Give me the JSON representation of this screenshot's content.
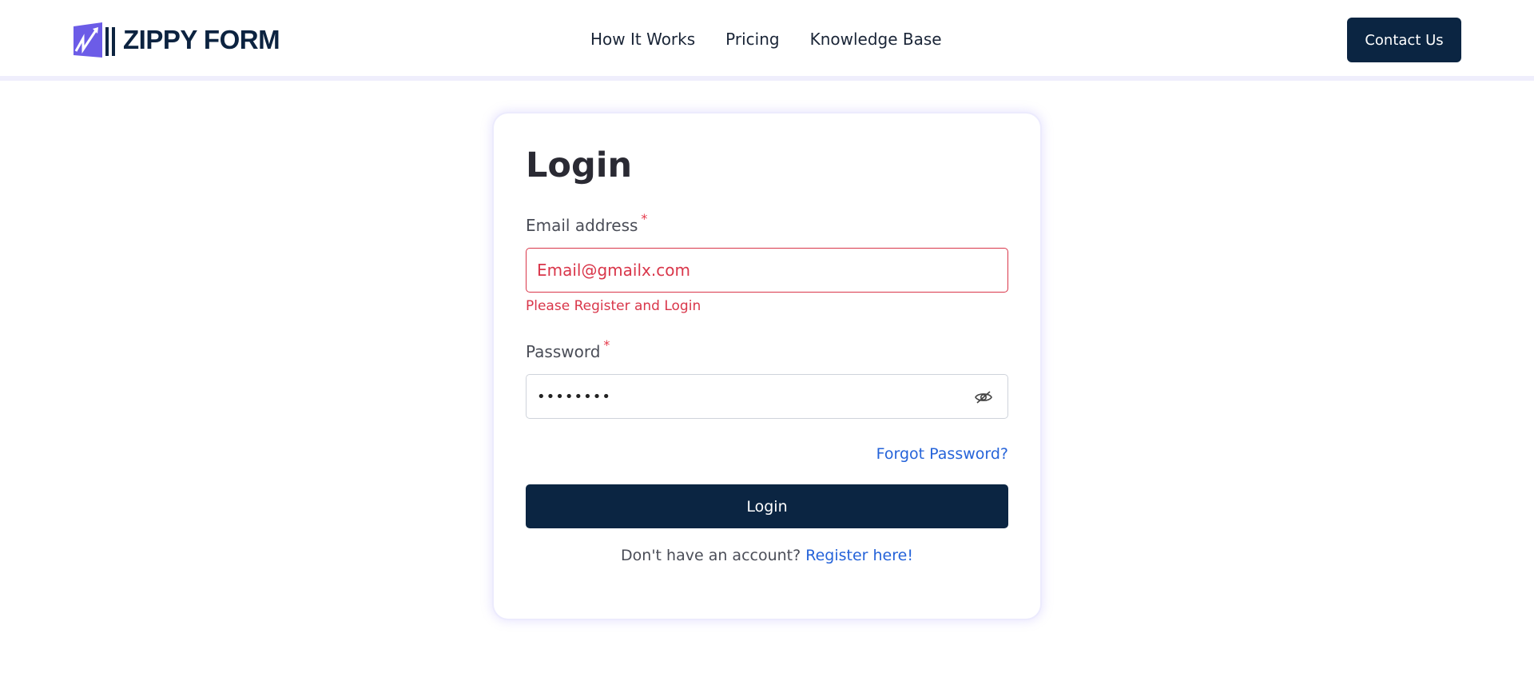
{
  "header": {
    "logo_text": "ZIPPY FORM",
    "nav": [
      "How It Works",
      "Pricing",
      "Knowledge Base"
    ],
    "contact_label": "Contact Us"
  },
  "login": {
    "title": "Login",
    "email_label": "Email address",
    "required_mark": "*",
    "email_value": "Email@gmailx.com",
    "email_error": "Please Register and Login",
    "password_label": "Password",
    "password_value": "••••••••",
    "forgot_label": "Forgot Password?",
    "submit_label": "Login",
    "register_prompt": "Don't have an account?",
    "register_link": "Register here!"
  },
  "colors": {
    "primary": "#0b2542",
    "logo_accent": "#6c5ce7",
    "error": "#d9364a",
    "link": "#2563d9"
  },
  "icons": [
    "zippy-form-logo-icon",
    "eye-slash-icon"
  ]
}
